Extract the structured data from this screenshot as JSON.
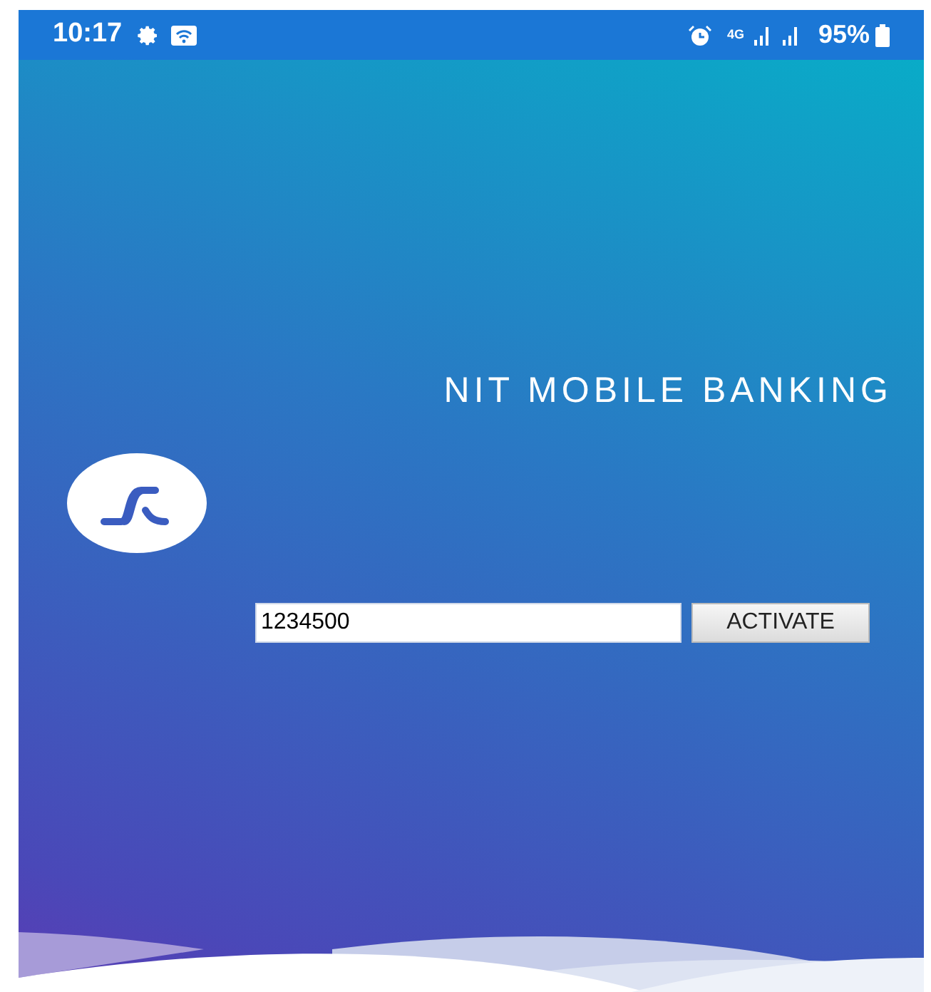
{
  "status_bar": {
    "time": "10:17",
    "network": "4G",
    "battery": "95%"
  },
  "title": "NIT MOBILE BANKING",
  "activation": {
    "value": "1234500",
    "button": "ACTIVATE"
  }
}
